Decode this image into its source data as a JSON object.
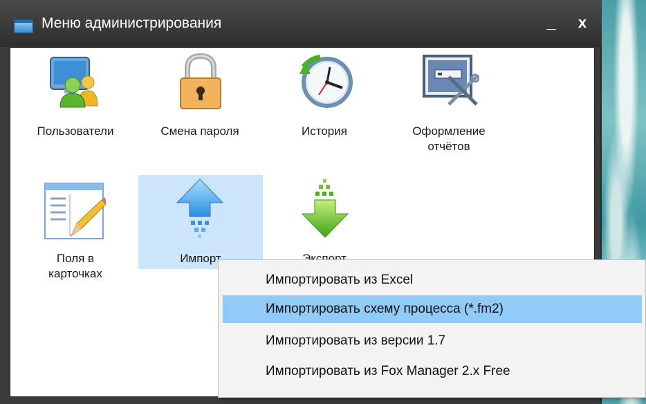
{
  "window": {
    "title": "Меню администрирования",
    "minimize_label": "_",
    "close_label": "x"
  },
  "tiles": [
    {
      "label": "Пользователи",
      "icon": "users-icon"
    },
    {
      "label": "Смена пароля",
      "icon": "padlock-icon"
    },
    {
      "label": "История",
      "icon": "history-clock-icon"
    },
    {
      "label": "Оформление\nотчётов",
      "icon": "report-design-icon"
    },
    {
      "label": "Поля в\nкарточках",
      "icon": "card-fields-icon"
    },
    {
      "label": "Импорт",
      "icon": "import-arrow-icon",
      "selected": true
    },
    {
      "label": "Экспорт",
      "icon": "export-arrow-icon"
    }
  ],
  "context_menu": {
    "items": [
      {
        "label": "Импортировать из Excel"
      },
      {
        "label": "Импортировать схему процесса (*.fm2)",
        "highlighted": true
      },
      {
        "label": "Импортировать из версии 1.7"
      },
      {
        "label": "Импортировать из Fox Manager 2.x Free"
      }
    ]
  },
  "colors": {
    "titlebar": "#3b3b3b",
    "selected_tile": "#cce5fb",
    "menu_highlight": "#91c9f7",
    "menu_background": "#f3f3f3"
  }
}
